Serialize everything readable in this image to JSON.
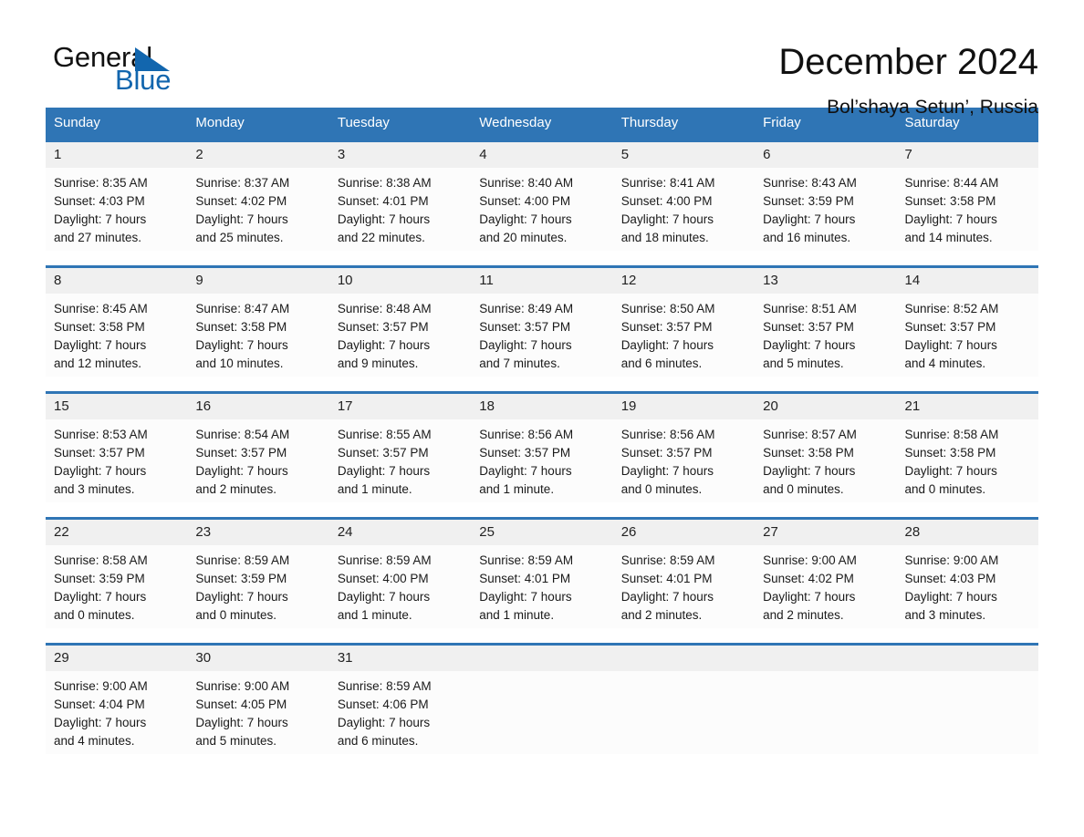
{
  "brand": {
    "name_part1": "General",
    "name_part2": "Blue",
    "accent_color": "#1266ae",
    "logo_icon": "triangle-logo-icon"
  },
  "header": {
    "title": "December 2024",
    "subtitle": "Bol’shaya Setun’, Russia"
  },
  "calendar": {
    "header_bg": "#2f75b5",
    "day_band_bg": "#f0f0f0",
    "weekdays": [
      "Sunday",
      "Monday",
      "Tuesday",
      "Wednesday",
      "Thursday",
      "Friday",
      "Saturday"
    ],
    "weeks": [
      [
        {
          "day": "1",
          "sunrise": "Sunrise: 8:35 AM",
          "sunset": "Sunset: 4:03 PM",
          "daylight_line1": "Daylight: 7 hours",
          "daylight_line2": "and 27 minutes."
        },
        {
          "day": "2",
          "sunrise": "Sunrise: 8:37 AM",
          "sunset": "Sunset: 4:02 PM",
          "daylight_line1": "Daylight: 7 hours",
          "daylight_line2": "and 25 minutes."
        },
        {
          "day": "3",
          "sunrise": "Sunrise: 8:38 AM",
          "sunset": "Sunset: 4:01 PM",
          "daylight_line1": "Daylight: 7 hours",
          "daylight_line2": "and 22 minutes."
        },
        {
          "day": "4",
          "sunrise": "Sunrise: 8:40 AM",
          "sunset": "Sunset: 4:00 PM",
          "daylight_line1": "Daylight: 7 hours",
          "daylight_line2": "and 20 minutes."
        },
        {
          "day": "5",
          "sunrise": "Sunrise: 8:41 AM",
          "sunset": "Sunset: 4:00 PM",
          "daylight_line1": "Daylight: 7 hours",
          "daylight_line2": "and 18 minutes."
        },
        {
          "day": "6",
          "sunrise": "Sunrise: 8:43 AM",
          "sunset": "Sunset: 3:59 PM",
          "daylight_line1": "Daylight: 7 hours",
          "daylight_line2": "and 16 minutes."
        },
        {
          "day": "7",
          "sunrise": "Sunrise: 8:44 AM",
          "sunset": "Sunset: 3:58 PM",
          "daylight_line1": "Daylight: 7 hours",
          "daylight_line2": "and 14 minutes."
        }
      ],
      [
        {
          "day": "8",
          "sunrise": "Sunrise: 8:45 AM",
          "sunset": "Sunset: 3:58 PM",
          "daylight_line1": "Daylight: 7 hours",
          "daylight_line2": "and 12 minutes."
        },
        {
          "day": "9",
          "sunrise": "Sunrise: 8:47 AM",
          "sunset": "Sunset: 3:58 PM",
          "daylight_line1": "Daylight: 7 hours",
          "daylight_line2": "and 10 minutes."
        },
        {
          "day": "10",
          "sunrise": "Sunrise: 8:48 AM",
          "sunset": "Sunset: 3:57 PM",
          "daylight_line1": "Daylight: 7 hours",
          "daylight_line2": "and 9 minutes."
        },
        {
          "day": "11",
          "sunrise": "Sunrise: 8:49 AM",
          "sunset": "Sunset: 3:57 PM",
          "daylight_line1": "Daylight: 7 hours",
          "daylight_line2": "and 7 minutes."
        },
        {
          "day": "12",
          "sunrise": "Sunrise: 8:50 AM",
          "sunset": "Sunset: 3:57 PM",
          "daylight_line1": "Daylight: 7 hours",
          "daylight_line2": "and 6 minutes."
        },
        {
          "day": "13",
          "sunrise": "Sunrise: 8:51 AM",
          "sunset": "Sunset: 3:57 PM",
          "daylight_line1": "Daylight: 7 hours",
          "daylight_line2": "and 5 minutes."
        },
        {
          "day": "14",
          "sunrise": "Sunrise: 8:52 AM",
          "sunset": "Sunset: 3:57 PM",
          "daylight_line1": "Daylight: 7 hours",
          "daylight_line2": "and 4 minutes."
        }
      ],
      [
        {
          "day": "15",
          "sunrise": "Sunrise: 8:53 AM",
          "sunset": "Sunset: 3:57 PM",
          "daylight_line1": "Daylight: 7 hours",
          "daylight_line2": "and 3 minutes."
        },
        {
          "day": "16",
          "sunrise": "Sunrise: 8:54 AM",
          "sunset": "Sunset: 3:57 PM",
          "daylight_line1": "Daylight: 7 hours",
          "daylight_line2": "and 2 minutes."
        },
        {
          "day": "17",
          "sunrise": "Sunrise: 8:55 AM",
          "sunset": "Sunset: 3:57 PM",
          "daylight_line1": "Daylight: 7 hours",
          "daylight_line2": "and 1 minute."
        },
        {
          "day": "18",
          "sunrise": "Sunrise: 8:56 AM",
          "sunset": "Sunset: 3:57 PM",
          "daylight_line1": "Daylight: 7 hours",
          "daylight_line2": "and 1 minute."
        },
        {
          "day": "19",
          "sunrise": "Sunrise: 8:56 AM",
          "sunset": "Sunset: 3:57 PM",
          "daylight_line1": "Daylight: 7 hours",
          "daylight_line2": "and 0 minutes."
        },
        {
          "day": "20",
          "sunrise": "Sunrise: 8:57 AM",
          "sunset": "Sunset: 3:58 PM",
          "daylight_line1": "Daylight: 7 hours",
          "daylight_line2": "and 0 minutes."
        },
        {
          "day": "21",
          "sunrise": "Sunrise: 8:58 AM",
          "sunset": "Sunset: 3:58 PM",
          "daylight_line1": "Daylight: 7 hours",
          "daylight_line2": "and 0 minutes."
        }
      ],
      [
        {
          "day": "22",
          "sunrise": "Sunrise: 8:58 AM",
          "sunset": "Sunset: 3:59 PM",
          "daylight_line1": "Daylight: 7 hours",
          "daylight_line2": "and 0 minutes."
        },
        {
          "day": "23",
          "sunrise": "Sunrise: 8:59 AM",
          "sunset": "Sunset: 3:59 PM",
          "daylight_line1": "Daylight: 7 hours",
          "daylight_line2": "and 0 minutes."
        },
        {
          "day": "24",
          "sunrise": "Sunrise: 8:59 AM",
          "sunset": "Sunset: 4:00 PM",
          "daylight_line1": "Daylight: 7 hours",
          "daylight_line2": "and 1 minute."
        },
        {
          "day": "25",
          "sunrise": "Sunrise: 8:59 AM",
          "sunset": "Sunset: 4:01 PM",
          "daylight_line1": "Daylight: 7 hours",
          "daylight_line2": "and 1 minute."
        },
        {
          "day": "26",
          "sunrise": "Sunrise: 8:59 AM",
          "sunset": "Sunset: 4:01 PM",
          "daylight_line1": "Daylight: 7 hours",
          "daylight_line2": "and 2 minutes."
        },
        {
          "day": "27",
          "sunrise": "Sunrise: 9:00 AM",
          "sunset": "Sunset: 4:02 PM",
          "daylight_line1": "Daylight: 7 hours",
          "daylight_line2": "and 2 minutes."
        },
        {
          "day": "28",
          "sunrise": "Sunrise: 9:00 AM",
          "sunset": "Sunset: 4:03 PM",
          "daylight_line1": "Daylight: 7 hours",
          "daylight_line2": "and 3 minutes."
        }
      ],
      [
        {
          "day": "29",
          "sunrise": "Sunrise: 9:00 AM",
          "sunset": "Sunset: 4:04 PM",
          "daylight_line1": "Daylight: 7 hours",
          "daylight_line2": "and 4 minutes."
        },
        {
          "day": "30",
          "sunrise": "Sunrise: 9:00 AM",
          "sunset": "Sunset: 4:05 PM",
          "daylight_line1": "Daylight: 7 hours",
          "daylight_line2": "and 5 minutes."
        },
        {
          "day": "31",
          "sunrise": "Sunrise: 8:59 AM",
          "sunset": "Sunset: 4:06 PM",
          "daylight_line1": "Daylight: 7 hours",
          "daylight_line2": "and 6 minutes."
        },
        {
          "day": "",
          "sunrise": "",
          "sunset": "",
          "daylight_line1": "",
          "daylight_line2": ""
        },
        {
          "day": "",
          "sunrise": "",
          "sunset": "",
          "daylight_line1": "",
          "daylight_line2": ""
        },
        {
          "day": "",
          "sunrise": "",
          "sunset": "",
          "daylight_line1": "",
          "daylight_line2": ""
        },
        {
          "day": "",
          "sunrise": "",
          "sunset": "",
          "daylight_line1": "",
          "daylight_line2": ""
        }
      ]
    ]
  }
}
